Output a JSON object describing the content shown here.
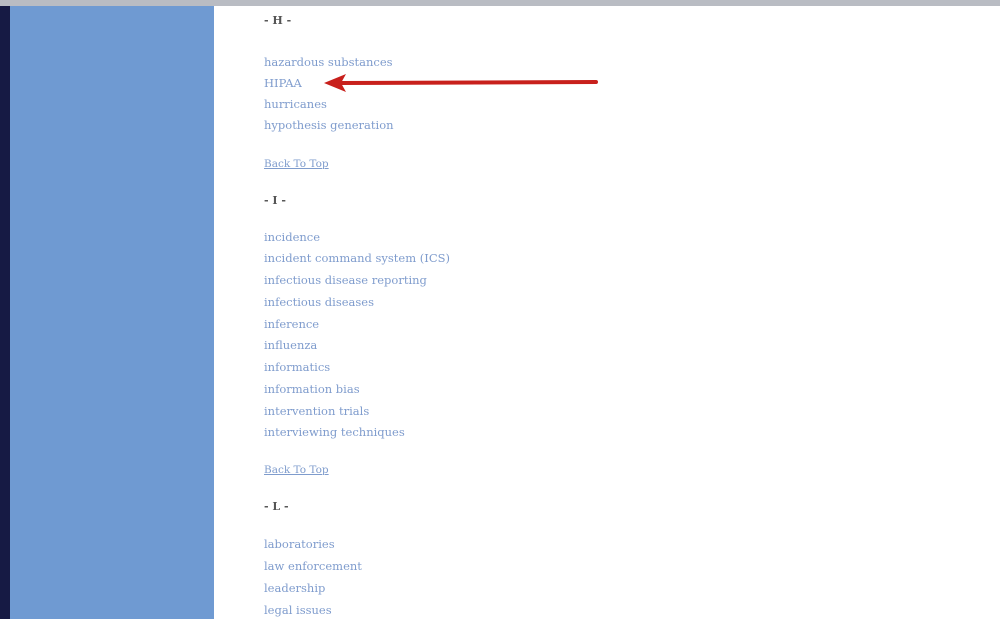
{
  "sections": {
    "h": {
      "heading": "- H -",
      "items": [
        "hazardous substances",
        "HIPAA",
        "hurricanes",
        "hypothesis generation"
      ],
      "back_to_top": "Back To Top"
    },
    "i": {
      "heading": "- I -",
      "items": [
        "incidence",
        "incident command system (ICS)",
        "infectious disease reporting",
        "infectious diseases",
        "inference",
        "influenza",
        "informatics",
        "information bias",
        "intervention trials",
        "interviewing techniques"
      ],
      "back_to_top": "Back To Top"
    },
    "l": {
      "heading": "- L -",
      "items": [
        "laboratories",
        "law enforcement",
        "leadership",
        "legal issues"
      ]
    }
  },
  "colors": {
    "sidebar": "#6f9ad2",
    "link": "#7f9ccd",
    "arrow": "#c8201c"
  }
}
